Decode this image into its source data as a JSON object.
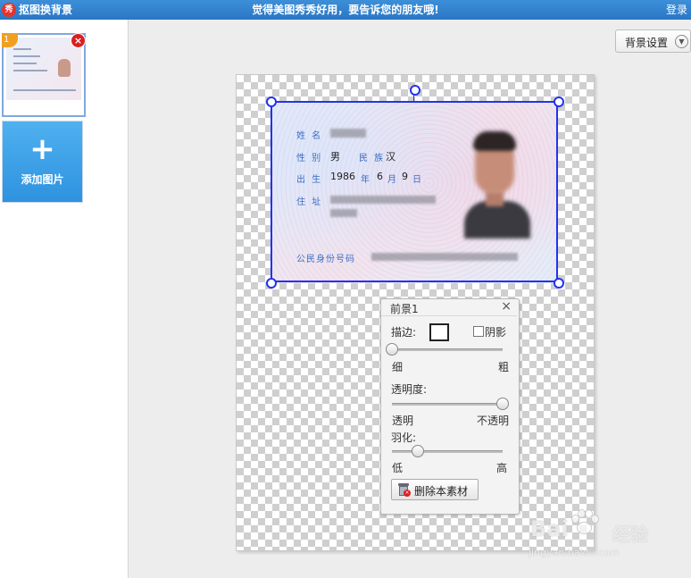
{
  "titlebar": {
    "logo": "秀",
    "title": "抠图换背景",
    "slogan": "觉得美图秀秀好用，要告诉您的朋友哦!",
    "login": "登录"
  },
  "left_panel": {
    "thumb_index": "1",
    "thumb_close": "×",
    "add_button_icon": "+",
    "add_button_label": "添加图片"
  },
  "toolbar": {
    "bg_settings_label": "背景设置",
    "bg_settings_icon": "chevron-down-icon"
  },
  "id_card": {
    "name_label": "姓 名",
    "sex_label": "性 别",
    "sex_value": "男",
    "ethnicity_label": "民 族",
    "ethnicity_value": "汉",
    "birth_label": "出 生",
    "birth_year": "1986",
    "year_char": "年",
    "birth_month": "6",
    "month_char": "月",
    "birth_day": "9",
    "day_char": "日",
    "address_label": "住 址",
    "id_label": "公民身份号码"
  },
  "panel": {
    "title": "前景1",
    "close": "×",
    "stroke_label": "描边:",
    "shadow_label": "阴影",
    "thin_label": "细",
    "thick_label": "粗",
    "opacity_label": "透明度:",
    "transparent_label": "透明",
    "opaque_label": "不透明",
    "feather_label": "羽化:",
    "low_label": "低",
    "high_label": "高",
    "delete_label": "删除本素材",
    "stroke_value": 0,
    "opacity_value": 1.0,
    "feather_value": 0.23,
    "shadow_checked": false
  },
  "watermark": {
    "brand_left": "Bai",
    "brand_right": "经验",
    "url": "jingyan.baidu.com"
  },
  "colors": {
    "titlebar": "#2a76c4",
    "accent": "#2e92e0",
    "selection": "#2233ee"
  }
}
